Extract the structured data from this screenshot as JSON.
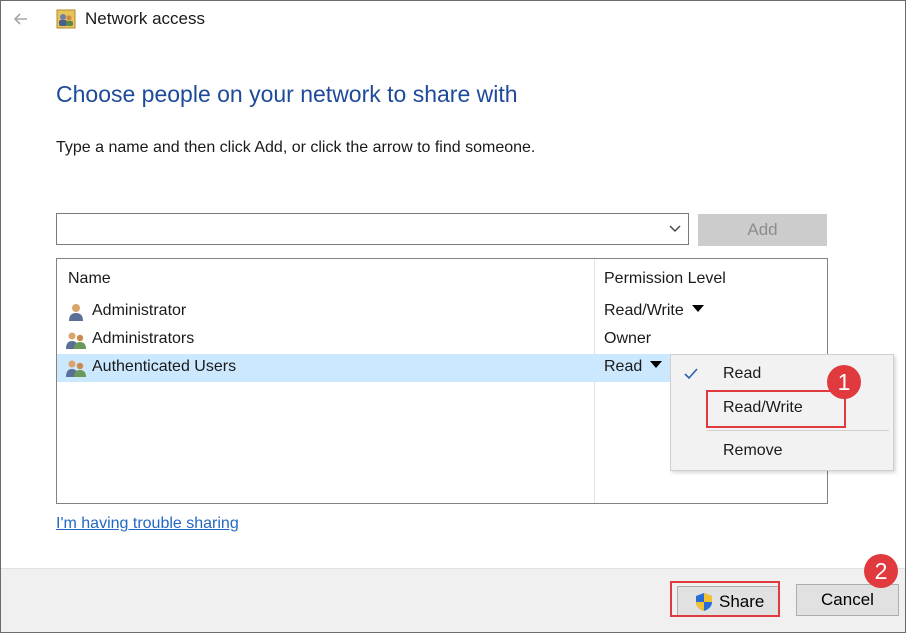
{
  "window": {
    "title": "Network access",
    "back_icon": "back-arrow-icon",
    "title_icon": "network-users-icon"
  },
  "main": {
    "heading": "Choose people on your network to share with",
    "instruction": "Type a name and then click Add, or click the arrow to find someone.",
    "name_input": {
      "value": "",
      "placeholder": ""
    },
    "add_label": "Add"
  },
  "list": {
    "columns": [
      "Name",
      "Permission Level"
    ],
    "rows": [
      {
        "name": "Administrator",
        "permission": "Read/Write",
        "icon": "user-icon",
        "has_dropdown": true,
        "selected": false
      },
      {
        "name": "Administrators",
        "permission": "Owner",
        "icon": "group-icon",
        "has_dropdown": false,
        "selected": false
      },
      {
        "name": "Authenticated Users",
        "permission": "Read",
        "icon": "group-icon",
        "has_dropdown": true,
        "selected": true
      }
    ]
  },
  "permission_menu": {
    "items": [
      {
        "label": "Read",
        "checked": true
      },
      {
        "label": "Read/Write",
        "checked": false
      },
      {
        "label": "Remove",
        "checked": false
      }
    ]
  },
  "trouble_link": "I'm having trouble sharing",
  "footer": {
    "share_label": "Share",
    "cancel_label": "Cancel"
  },
  "annotations": {
    "step1": "1",
    "step2": "2",
    "color": "#e0393e"
  },
  "colors": {
    "heading": "#1e4a9a",
    "link": "#2368c4",
    "selection": "#cce8ff"
  }
}
